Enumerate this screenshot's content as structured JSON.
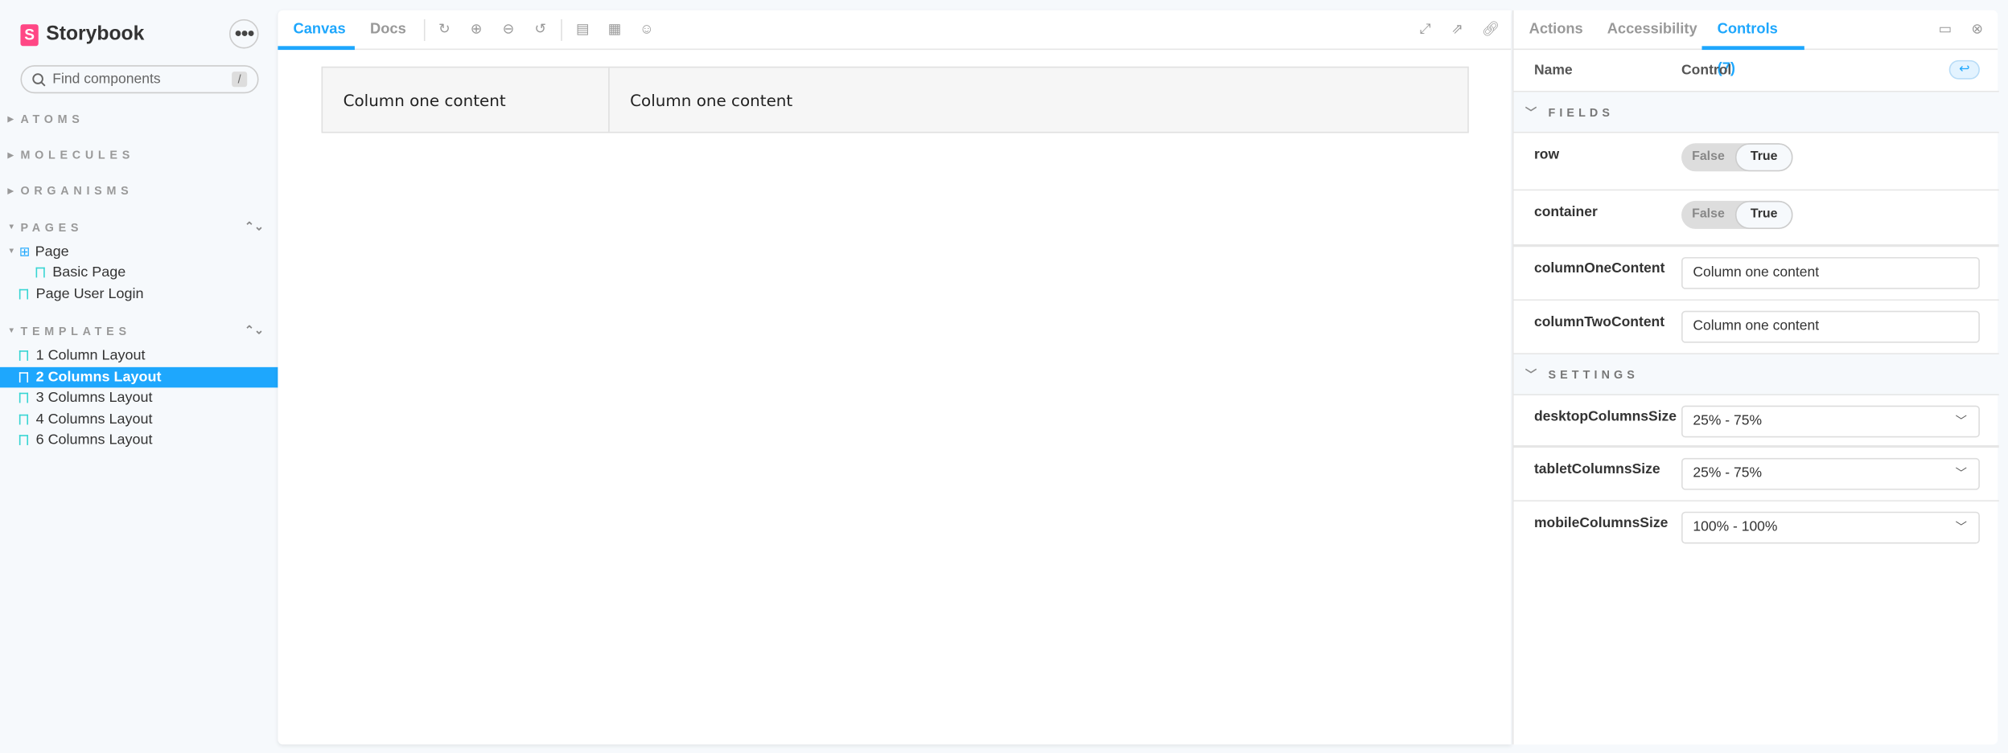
{
  "sidebar": {
    "brand": "Storybook",
    "search_placeholder": "Find components",
    "search_shortcut": "/",
    "groups": {
      "atoms": "ATOMS",
      "molecules": "MOLECULES",
      "organisms": "ORGANISMS",
      "pages": "PAGES",
      "templates": "TEMPLATES"
    },
    "pages_items": [
      "Page",
      "Basic Page",
      "Page User Login"
    ],
    "templates_items": [
      "1 Column Layout",
      "2 Columns Layout",
      "3 Columns Layout",
      "4 Columns Layout",
      "6 Columns Layout"
    ],
    "selected": "2 Columns Layout"
  },
  "toolbar": {
    "tabs": [
      "Canvas",
      "Docs"
    ],
    "active_tab": "Canvas"
  },
  "preview": {
    "col1": "Column one content",
    "col2": "Column one content"
  },
  "addons": {
    "tabs": [
      "Actions",
      "Accessibility",
      "Controls (7)"
    ],
    "active_tab": "Controls (7)",
    "header": {
      "name": "Name",
      "control": "Control"
    },
    "sections": {
      "fields": "FIELDS",
      "settings": "SETTINGS"
    },
    "toggle": {
      "false": "False",
      "true": "True"
    },
    "controls": {
      "row": {
        "name": "row",
        "value": "True"
      },
      "container": {
        "name": "container",
        "value": "True"
      },
      "columnOneContent": {
        "name": "columnOneContent",
        "value": "Column one content"
      },
      "columnTwoContent": {
        "name": "columnTwoContent",
        "value": "Column one content"
      },
      "desktopColumnsSize": {
        "name": "desktopColumnsSize",
        "value": "25% - 75%"
      },
      "tabletColumnsSize": {
        "name": "tabletColumnsSize",
        "value": "25% - 75%"
      },
      "mobileColumnsSize": {
        "name": "mobileColumnsSize",
        "value": "100% - 100%"
      }
    }
  },
  "colors": {
    "accent": "#1ea7fd",
    "brand": "#ff4785",
    "story": "#37d5d3"
  }
}
